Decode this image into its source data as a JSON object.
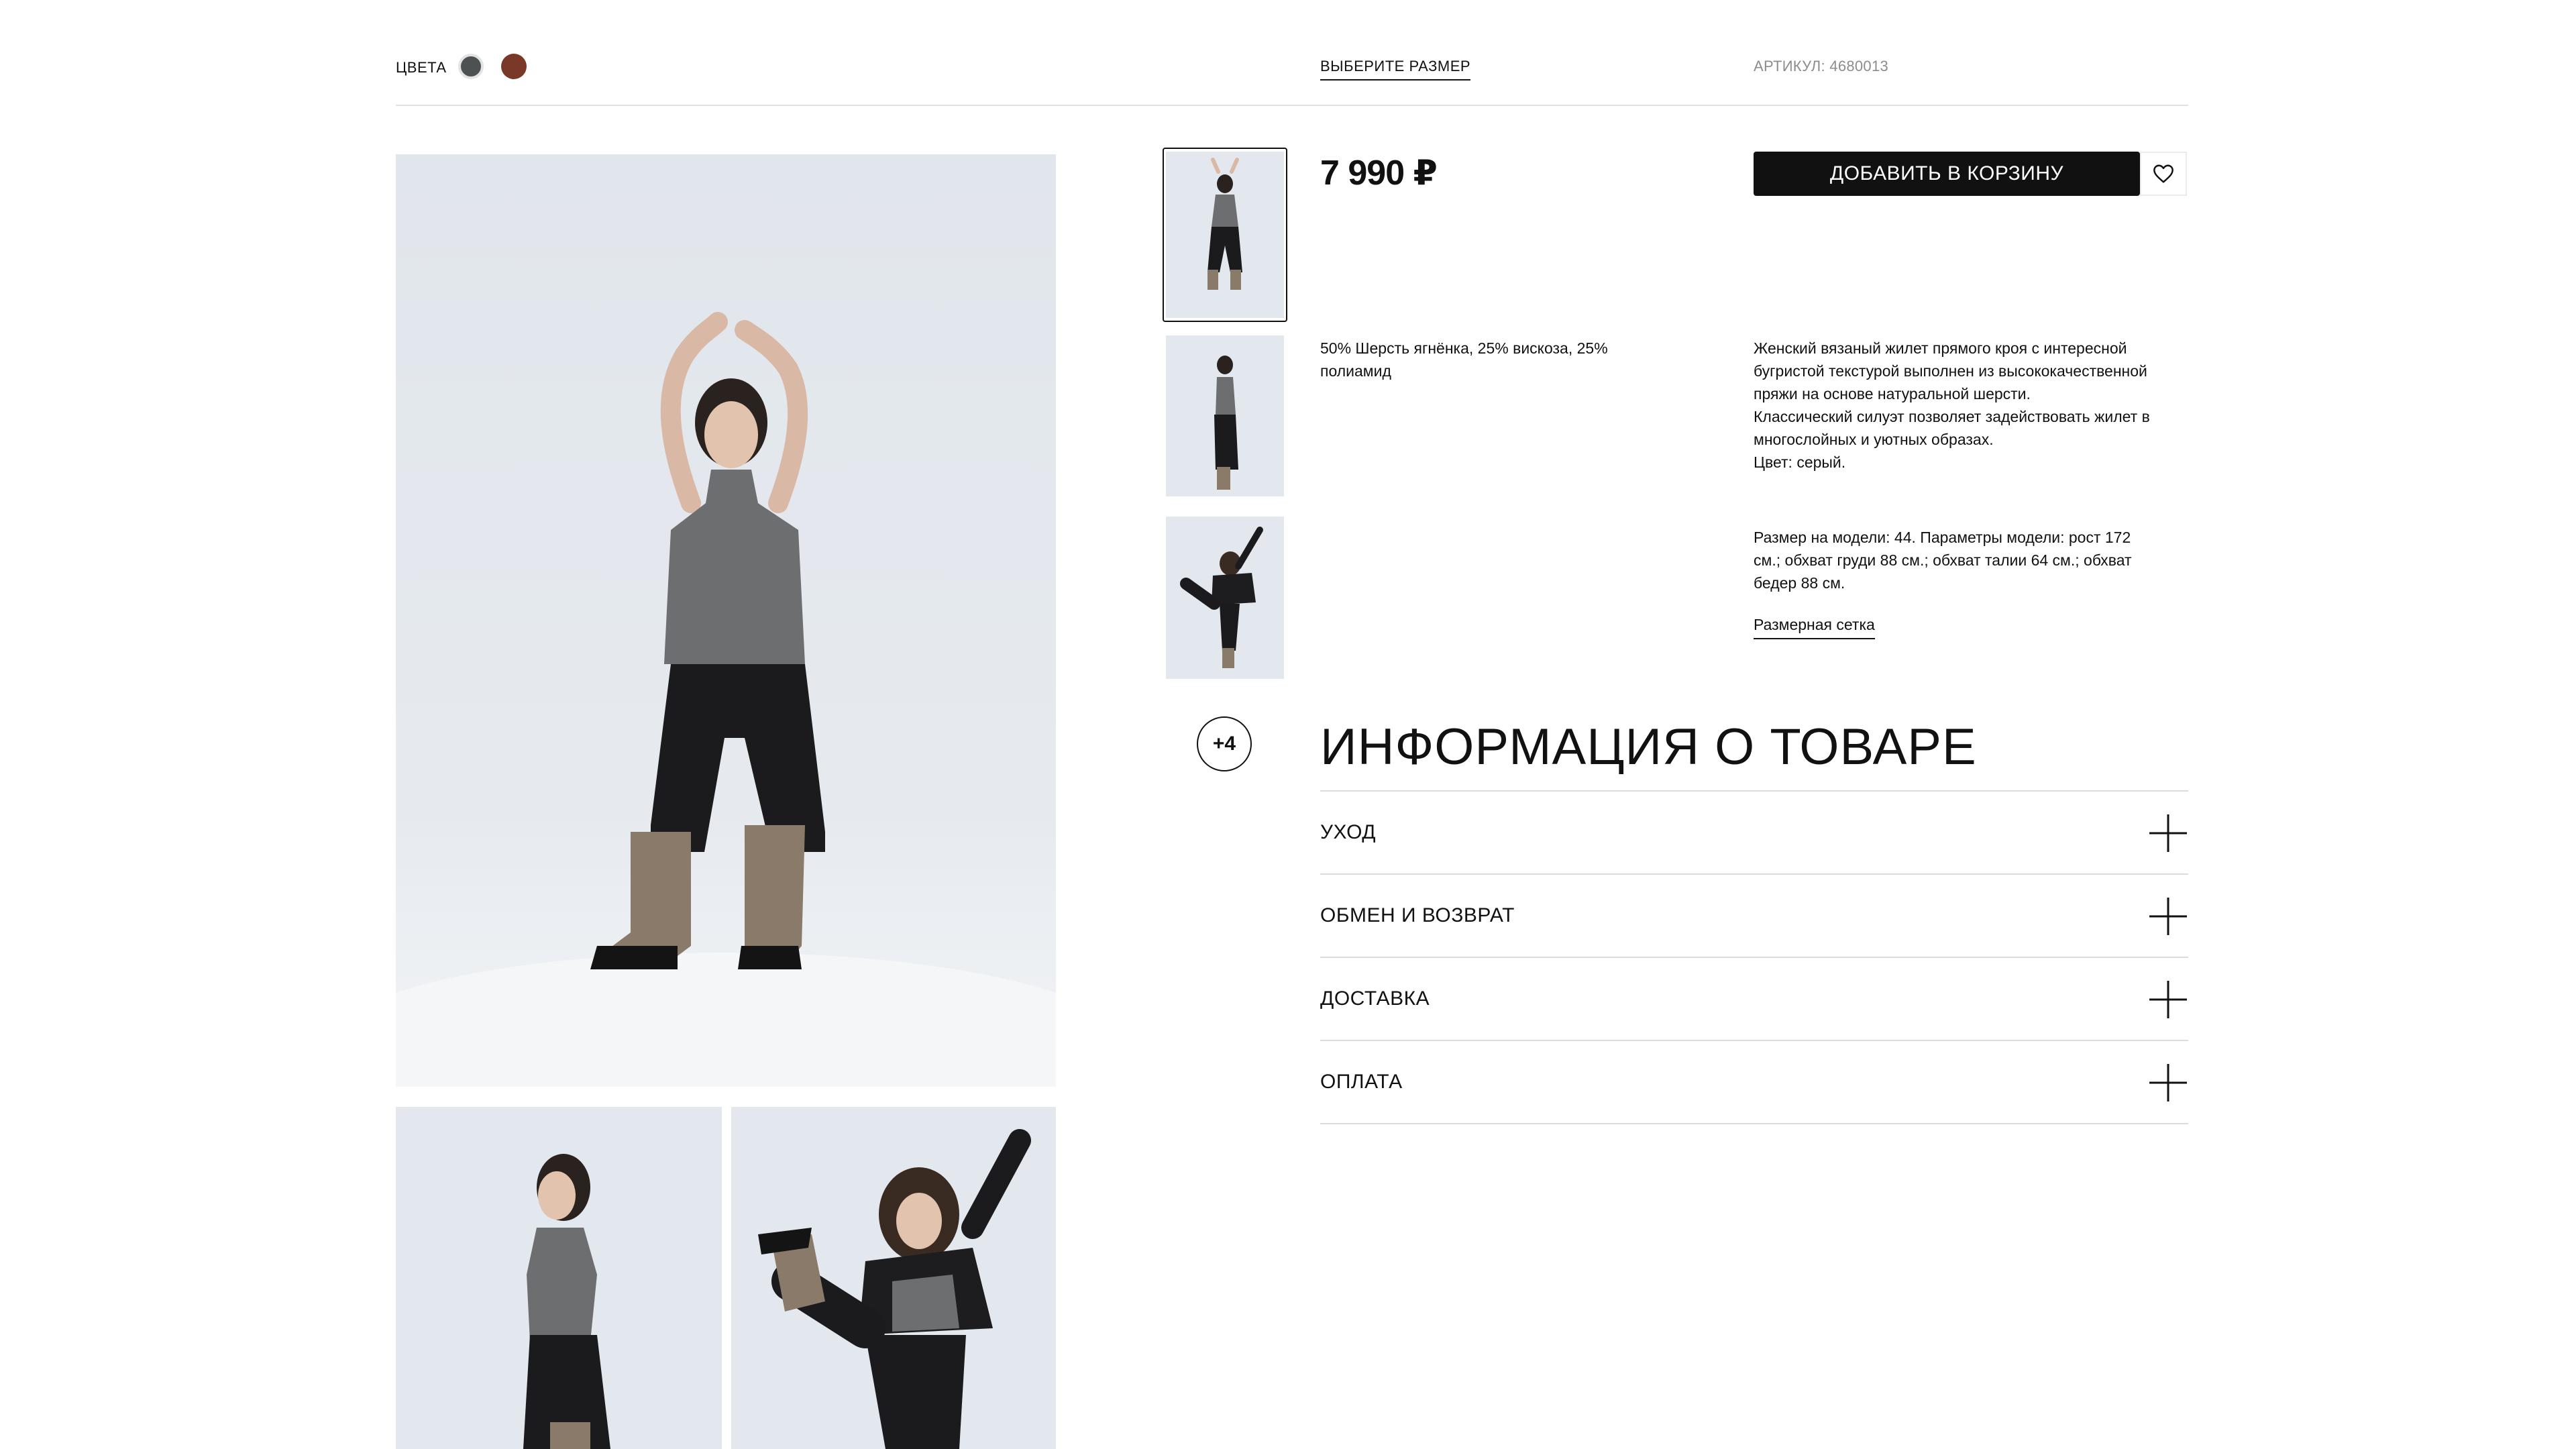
{
  "top_bar": {
    "colors_label": "ЦВЕТА",
    "color_swatches": [
      "#4e5152",
      "#7a3828"
    ],
    "size_select_label": "ВЫБЕРИТЕ РАЗМЕР",
    "sku": "АРТИКУЛ: 4680013"
  },
  "product": {
    "price": "7 990 ₽",
    "add_to_cart_label": "ДОБАВИТЬ В КОРЗИНУ",
    "composition": "50% Шерсть ягнёнка, 25% вискоза, 25% полиамид",
    "description": [
      "Женский вязаный жилет прямого кроя с интересной бугристой текстурой выполнен из высококачественной пряжи на основе натуральной шерсти.",
      "Классический силуэт позволяет задействовать жилет в многослойных и уютных образах.",
      "Цвет: серый."
    ],
    "model_params": "Размер на модели: 44. Параметры модели: рост 172 см.; обхват груди 88 см.; обхват талии 64 см.; обхват бедер 88 см.",
    "size_chart_link": "Размерная сетка"
  },
  "gallery": {
    "more_label": "+4"
  },
  "info": {
    "title": "ИНФОРМАЦИЯ О ТОВАРЕ",
    "sections": [
      {
        "label": "УХОД"
      },
      {
        "label": "ОБМЕН И ВОЗВРАТ"
      },
      {
        "label": "ДОСТАВКА"
      },
      {
        "label": "ОПЛАТА"
      }
    ]
  }
}
